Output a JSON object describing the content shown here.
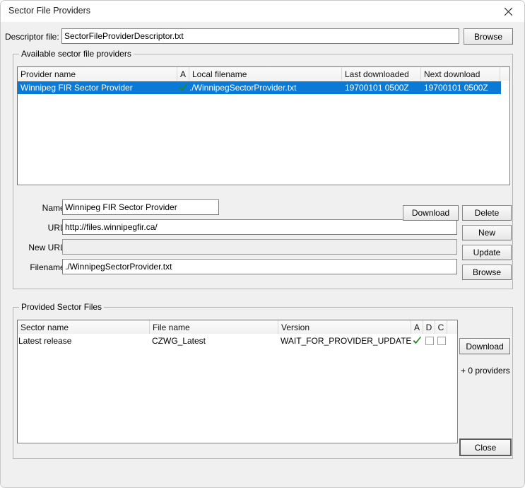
{
  "window": {
    "title": "Sector File Providers",
    "close_icon": "close-icon"
  },
  "descriptor": {
    "label": "Descriptor file:",
    "value": "SectorFileProviderDescriptor.txt",
    "placeholder": "",
    "browse_label": "Browse"
  },
  "providers_group": {
    "title": "Available sector file providers",
    "columns": [
      {
        "key": "provider_name",
        "label": "Provider name"
      },
      {
        "key": "a",
        "label": "A"
      },
      {
        "key": "local_filename",
        "label": "Local filename"
      },
      {
        "key": "last_downloaded",
        "label": "Last downloaded"
      },
      {
        "key": "next_download",
        "label": "Next download"
      },
      {
        "key": "filler",
        "label": ""
      }
    ],
    "rows": [
      {
        "provider_name": "Winnipeg FIR Sector Provider",
        "a": "check",
        "local_filename": "./WinnipegSectorProvider.txt",
        "last_downloaded": "19700101 0500Z",
        "next_download": "19700101 0500Z",
        "selected": true
      }
    ]
  },
  "details": {
    "name_label": "Name:",
    "name_value": "Winnipeg FIR Sector Provider",
    "url_label": "URL:",
    "url_value": "http://files.winnipegfir.ca/",
    "new_url_label": "New URL:",
    "new_url_value": "",
    "new_url_placeholder": "",
    "filename_label": "Filename:",
    "filename_value": "./WinnipegSectorProvider.txt",
    "buttons": {
      "download": "Download",
      "delete": "Delete",
      "new": "New",
      "update": "Update",
      "browse": "Browse"
    }
  },
  "provided_group": {
    "title": "Provided Sector Files",
    "columns": [
      {
        "key": "sector_name",
        "label": "Sector name"
      },
      {
        "key": "file_name",
        "label": "File name"
      },
      {
        "key": "version",
        "label": "Version"
      },
      {
        "key": "a",
        "label": "A"
      },
      {
        "key": "d",
        "label": "D"
      },
      {
        "key": "c",
        "label": "C"
      },
      {
        "key": "filler",
        "label": ""
      }
    ],
    "rows": [
      {
        "sector_name": "Latest release",
        "file_name": "CZWG_Latest",
        "version": "WAIT_FOR_PROVIDER_UPDATE",
        "a": "check",
        "d": "unchecked",
        "c": "unchecked"
      }
    ],
    "download_label": "Download",
    "providers_count_label": "+ 0 providers"
  },
  "footer": {
    "close_label": "Close"
  },
  "colors": {
    "selection_blue": "#0a7ad6",
    "check_green": "#1f8a1f",
    "window_bg": "#f0f0f0",
    "field_bg": "#ffffff",
    "disabled_bg": "#efefef"
  }
}
